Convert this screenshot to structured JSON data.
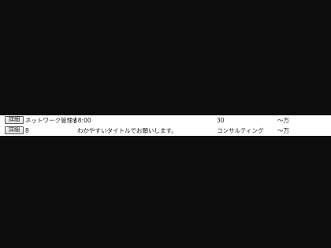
{
  "rows": [
    {
      "button_label": "詳細",
      "title": "ネットワーク管理者",
      "detail": "18:00",
      "category": "30",
      "salary": "～万"
    },
    {
      "button_label": "詳細",
      "title": "8",
      "detail": "わかやすいタイトルでお願いします。",
      "category": "コンサルティング",
      "salary": "～万"
    }
  ],
  "colors": {
    "background": "#0d0d0d",
    "list_background": "#ffffff",
    "text": "#222222"
  }
}
